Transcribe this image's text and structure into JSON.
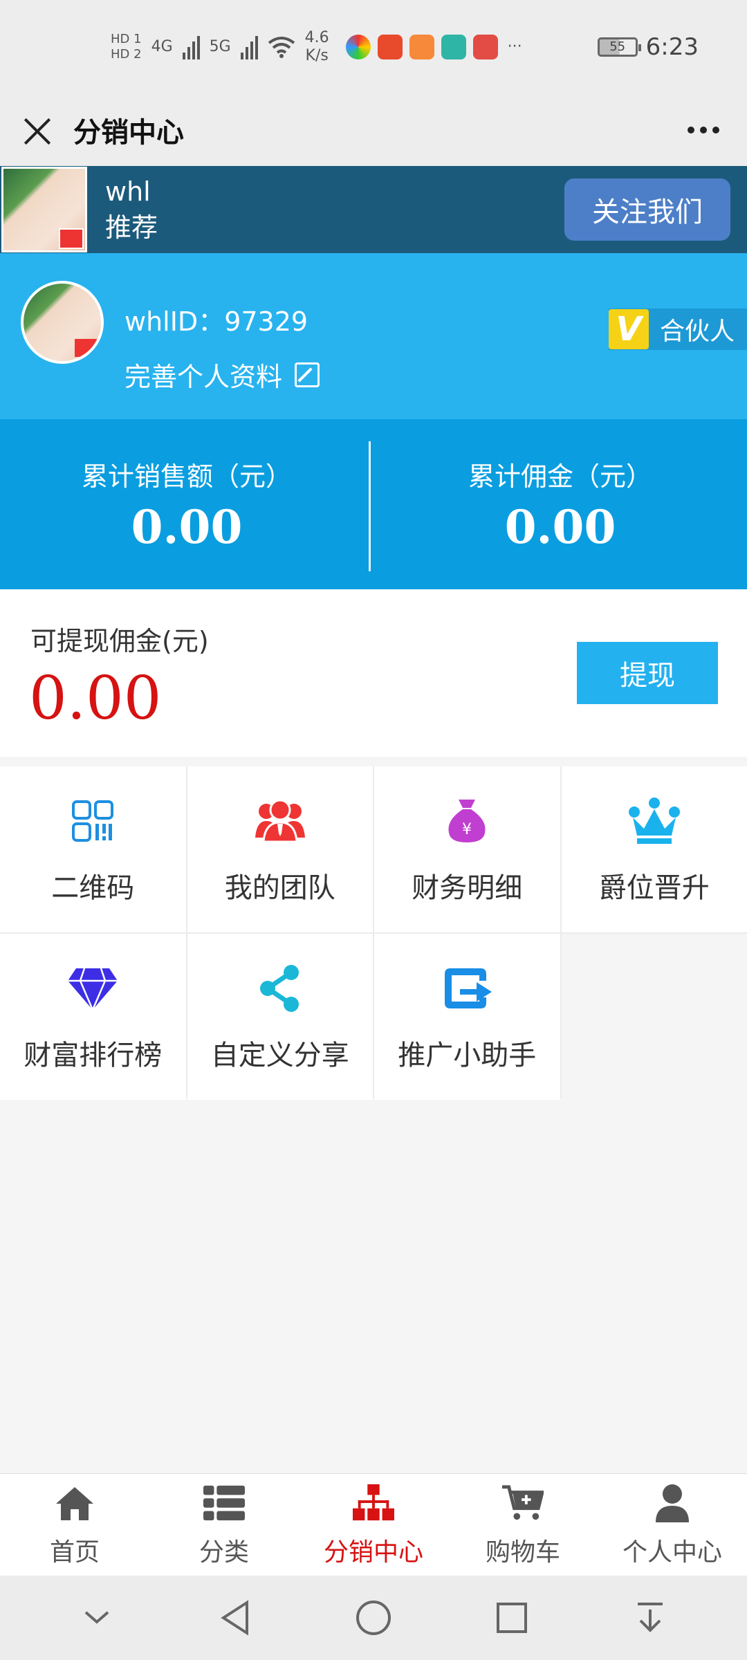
{
  "status_bar": {
    "hd1": "HD 1",
    "hd2": "HD 2",
    "net1": "4G",
    "net2": "5G",
    "speed_value": "4.6",
    "speed_unit": "K/s",
    "more": "···",
    "battery": "55",
    "time": "6:23"
  },
  "title_bar": {
    "title": "分销中心"
  },
  "referrer": {
    "name": "whl",
    "sub": "推荐",
    "follow_label": "关注我们"
  },
  "profile": {
    "id_text": "whlID：97329",
    "edit_text": "完善个人资料",
    "badge_v": "V",
    "badge_text": "合伙人"
  },
  "totals": {
    "sales_label": "累计销售额（元）",
    "sales_value": "0.00",
    "commission_label": "累计佣金（元）",
    "commission_value": "0.00"
  },
  "withdraw": {
    "label": "可提现佣金(元)",
    "value": "0.00",
    "button": "提现"
  },
  "grid": [
    {
      "label": "二维码",
      "icon": "qrcode-icon",
      "color": "#1e8fe0"
    },
    {
      "label": "我的团队",
      "icon": "team-icon",
      "color": "#ef3434"
    },
    {
      "label": "财务明细",
      "icon": "money-bag-icon",
      "color": "#c13fd0"
    },
    {
      "label": "爵位晋升",
      "icon": "crown-icon",
      "color": "#1ab2ec"
    },
    {
      "label": "财富排行榜",
      "icon": "diamond-icon",
      "color": "#3d2ee6"
    },
    {
      "label": "自定义分享",
      "icon": "share-icon",
      "color": "#1ab8d6"
    },
    {
      "label": "推广小助手",
      "icon": "promote-icon",
      "color": "#1a8ee6"
    }
  ],
  "bottom_nav": [
    {
      "label": "首页",
      "icon": "home-icon"
    },
    {
      "label": "分类",
      "icon": "list-icon"
    },
    {
      "label": "分销中心",
      "icon": "org-chart-icon",
      "active": true
    },
    {
      "label": "购物车",
      "icon": "cart-icon"
    },
    {
      "label": "个人中心",
      "icon": "user-icon"
    }
  ],
  "colors": {
    "profile_bg": "#28b3ef",
    "totals_bg": "#0a9ee0",
    "referrer_bg": "#1c5a7c",
    "active_nav": "#d61212",
    "withdraw_value": "#d61212"
  }
}
